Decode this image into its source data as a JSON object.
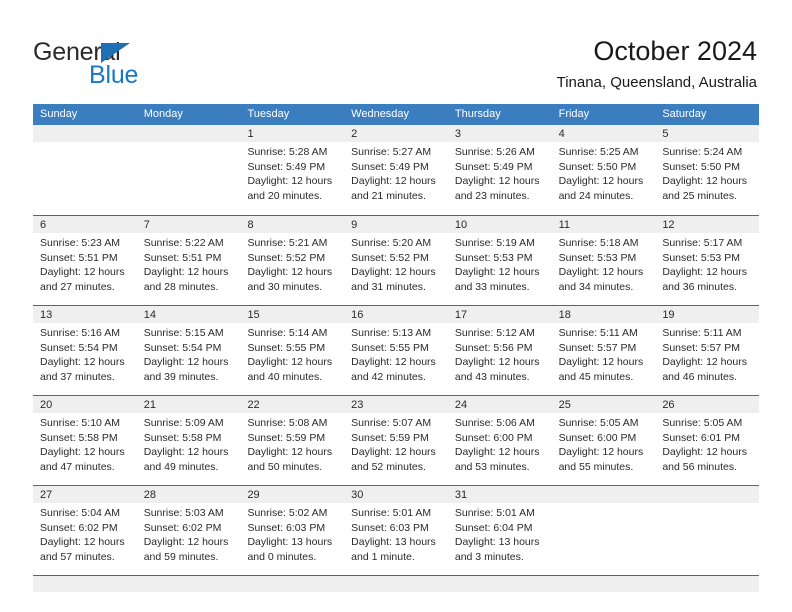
{
  "logo": {
    "word_one": "General",
    "word_two": "Blue",
    "triangle_color": "#1f6fb5",
    "blue_color": "#1878c8"
  },
  "header": {
    "title": "October 2024",
    "subtitle": "Tinana, Queensland, Australia"
  },
  "theme": {
    "header_bg": "#3b7ebf",
    "header_text": "#ffffff",
    "row_divider": "#2f6fae",
    "daynum_band": "#efefef",
    "body_text": "#2a2a2a"
  },
  "calendar": {
    "day_names": [
      "Sunday",
      "Monday",
      "Tuesday",
      "Wednesday",
      "Thursday",
      "Friday",
      "Saturday"
    ],
    "weeks": [
      [
        {
          "day": "",
          "sunrise": "",
          "sunset": "",
          "daylight_1": "",
          "daylight_2": ""
        },
        {
          "day": "",
          "sunrise": "",
          "sunset": "",
          "daylight_1": "",
          "daylight_2": ""
        },
        {
          "day": "1",
          "sunrise": "Sunrise: 5:28 AM",
          "sunset": "Sunset: 5:49 PM",
          "daylight_1": "Daylight: 12 hours",
          "daylight_2": "and 20 minutes."
        },
        {
          "day": "2",
          "sunrise": "Sunrise: 5:27 AM",
          "sunset": "Sunset: 5:49 PM",
          "daylight_1": "Daylight: 12 hours",
          "daylight_2": "and 21 minutes."
        },
        {
          "day": "3",
          "sunrise": "Sunrise: 5:26 AM",
          "sunset": "Sunset: 5:49 PM",
          "daylight_1": "Daylight: 12 hours",
          "daylight_2": "and 23 minutes."
        },
        {
          "day": "4",
          "sunrise": "Sunrise: 5:25 AM",
          "sunset": "Sunset: 5:50 PM",
          "daylight_1": "Daylight: 12 hours",
          "daylight_2": "and 24 minutes."
        },
        {
          "day": "5",
          "sunrise": "Sunrise: 5:24 AM",
          "sunset": "Sunset: 5:50 PM",
          "daylight_1": "Daylight: 12 hours",
          "daylight_2": "and 25 minutes."
        }
      ],
      [
        {
          "day": "6",
          "sunrise": "Sunrise: 5:23 AM",
          "sunset": "Sunset: 5:51 PM",
          "daylight_1": "Daylight: 12 hours",
          "daylight_2": "and 27 minutes."
        },
        {
          "day": "7",
          "sunrise": "Sunrise: 5:22 AM",
          "sunset": "Sunset: 5:51 PM",
          "daylight_1": "Daylight: 12 hours",
          "daylight_2": "and 28 minutes."
        },
        {
          "day": "8",
          "sunrise": "Sunrise: 5:21 AM",
          "sunset": "Sunset: 5:52 PM",
          "daylight_1": "Daylight: 12 hours",
          "daylight_2": "and 30 minutes."
        },
        {
          "day": "9",
          "sunrise": "Sunrise: 5:20 AM",
          "sunset": "Sunset: 5:52 PM",
          "daylight_1": "Daylight: 12 hours",
          "daylight_2": "and 31 minutes."
        },
        {
          "day": "10",
          "sunrise": "Sunrise: 5:19 AM",
          "sunset": "Sunset: 5:53 PM",
          "daylight_1": "Daylight: 12 hours",
          "daylight_2": "and 33 minutes."
        },
        {
          "day": "11",
          "sunrise": "Sunrise: 5:18 AM",
          "sunset": "Sunset: 5:53 PM",
          "daylight_1": "Daylight: 12 hours",
          "daylight_2": "and 34 minutes."
        },
        {
          "day": "12",
          "sunrise": "Sunrise: 5:17 AM",
          "sunset": "Sunset: 5:53 PM",
          "daylight_1": "Daylight: 12 hours",
          "daylight_2": "and 36 minutes."
        }
      ],
      [
        {
          "day": "13",
          "sunrise": "Sunrise: 5:16 AM",
          "sunset": "Sunset: 5:54 PM",
          "daylight_1": "Daylight: 12 hours",
          "daylight_2": "and 37 minutes."
        },
        {
          "day": "14",
          "sunrise": "Sunrise: 5:15 AM",
          "sunset": "Sunset: 5:54 PM",
          "daylight_1": "Daylight: 12 hours",
          "daylight_2": "and 39 minutes."
        },
        {
          "day": "15",
          "sunrise": "Sunrise: 5:14 AM",
          "sunset": "Sunset: 5:55 PM",
          "daylight_1": "Daylight: 12 hours",
          "daylight_2": "and 40 minutes."
        },
        {
          "day": "16",
          "sunrise": "Sunrise: 5:13 AM",
          "sunset": "Sunset: 5:55 PM",
          "daylight_1": "Daylight: 12 hours",
          "daylight_2": "and 42 minutes."
        },
        {
          "day": "17",
          "sunrise": "Sunrise: 5:12 AM",
          "sunset": "Sunset: 5:56 PM",
          "daylight_1": "Daylight: 12 hours",
          "daylight_2": "and 43 minutes."
        },
        {
          "day": "18",
          "sunrise": "Sunrise: 5:11 AM",
          "sunset": "Sunset: 5:57 PM",
          "daylight_1": "Daylight: 12 hours",
          "daylight_2": "and 45 minutes."
        },
        {
          "day": "19",
          "sunrise": "Sunrise: 5:11 AM",
          "sunset": "Sunset: 5:57 PM",
          "daylight_1": "Daylight: 12 hours",
          "daylight_2": "and 46 minutes."
        }
      ],
      [
        {
          "day": "20",
          "sunrise": "Sunrise: 5:10 AM",
          "sunset": "Sunset: 5:58 PM",
          "daylight_1": "Daylight: 12 hours",
          "daylight_2": "and 47 minutes."
        },
        {
          "day": "21",
          "sunrise": "Sunrise: 5:09 AM",
          "sunset": "Sunset: 5:58 PM",
          "daylight_1": "Daylight: 12 hours",
          "daylight_2": "and 49 minutes."
        },
        {
          "day": "22",
          "sunrise": "Sunrise: 5:08 AM",
          "sunset": "Sunset: 5:59 PM",
          "daylight_1": "Daylight: 12 hours",
          "daylight_2": "and 50 minutes."
        },
        {
          "day": "23",
          "sunrise": "Sunrise: 5:07 AM",
          "sunset": "Sunset: 5:59 PM",
          "daylight_1": "Daylight: 12 hours",
          "daylight_2": "and 52 minutes."
        },
        {
          "day": "24",
          "sunrise": "Sunrise: 5:06 AM",
          "sunset": "Sunset: 6:00 PM",
          "daylight_1": "Daylight: 12 hours",
          "daylight_2": "and 53 minutes."
        },
        {
          "day": "25",
          "sunrise": "Sunrise: 5:05 AM",
          "sunset": "Sunset: 6:00 PM",
          "daylight_1": "Daylight: 12 hours",
          "daylight_2": "and 55 minutes."
        },
        {
          "day": "26",
          "sunrise": "Sunrise: 5:05 AM",
          "sunset": "Sunset: 6:01 PM",
          "daylight_1": "Daylight: 12 hours",
          "daylight_2": "and 56 minutes."
        }
      ],
      [
        {
          "day": "27",
          "sunrise": "Sunrise: 5:04 AM",
          "sunset": "Sunset: 6:02 PM",
          "daylight_1": "Daylight: 12 hours",
          "daylight_2": "and 57 minutes."
        },
        {
          "day": "28",
          "sunrise": "Sunrise: 5:03 AM",
          "sunset": "Sunset: 6:02 PM",
          "daylight_1": "Daylight: 12 hours",
          "daylight_2": "and 59 minutes."
        },
        {
          "day": "29",
          "sunrise": "Sunrise: 5:02 AM",
          "sunset": "Sunset: 6:03 PM",
          "daylight_1": "Daylight: 13 hours",
          "daylight_2": "and 0 minutes."
        },
        {
          "day": "30",
          "sunrise": "Sunrise: 5:01 AM",
          "sunset": "Sunset: 6:03 PM",
          "daylight_1": "Daylight: 13 hours",
          "daylight_2": "and 1 minute."
        },
        {
          "day": "31",
          "sunrise": "Sunrise: 5:01 AM",
          "sunset": "Sunset: 6:04 PM",
          "daylight_1": "Daylight: 13 hours",
          "daylight_2": "and 3 minutes."
        },
        {
          "day": "",
          "sunrise": "",
          "sunset": "",
          "daylight_1": "",
          "daylight_2": ""
        },
        {
          "day": "",
          "sunrise": "",
          "sunset": "",
          "daylight_1": "",
          "daylight_2": ""
        }
      ]
    ]
  }
}
